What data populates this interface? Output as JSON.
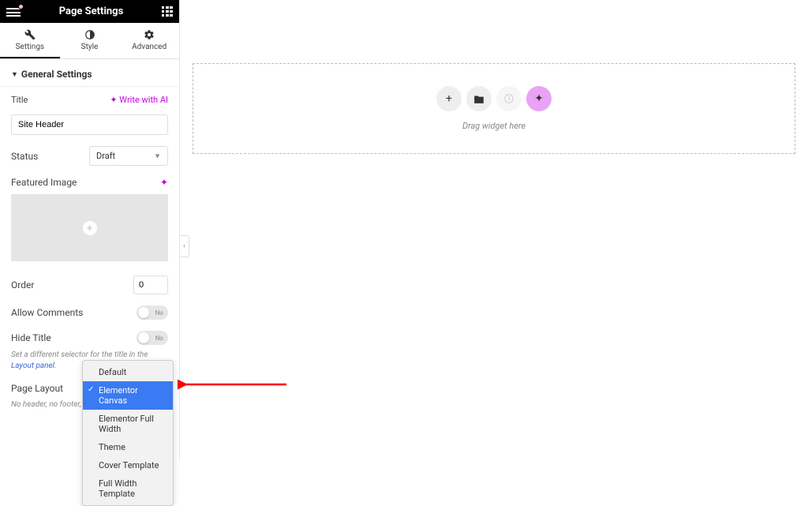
{
  "header": {
    "title": "Page Settings"
  },
  "tabs": {
    "settings": "Settings",
    "style": "Style",
    "advanced": "Advanced"
  },
  "section": {
    "general": "General Settings"
  },
  "controls": {
    "title_label": "Title",
    "ai_label": "Write with AI",
    "title_value": "Site Header",
    "status_label": "Status",
    "status_value": "Draft",
    "featured_label": "Featured Image",
    "order_label": "Order",
    "order_value": "0",
    "comments_label": "Allow Comments",
    "comments_state": "No",
    "hide_title_label": "Hide Title",
    "hide_title_state": "No",
    "hide_title_help_prefix": "Set a different selector for the title in the ",
    "hide_title_help_link": "Layout panel",
    "hide_title_help_suffix": ".",
    "layout_label": "Page Layout",
    "layout_footer": "No header, no footer, ju"
  },
  "dropdown": {
    "items": [
      "Default",
      "Elementor Canvas",
      "Elementor Full Width",
      "Theme",
      "Cover Template",
      "Full Width Template"
    ],
    "selected_index": 1
  },
  "canvas": {
    "drop_text": "Drag widget here"
  }
}
